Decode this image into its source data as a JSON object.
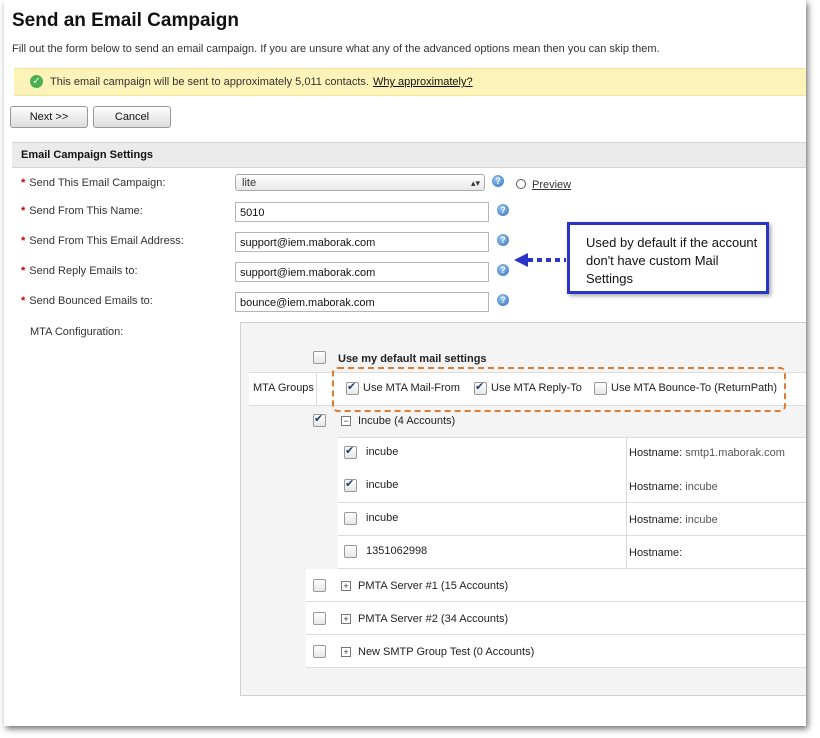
{
  "page": {
    "title": "Send an Email Campaign",
    "intro": "Fill out the form below to send an email campaign. If you are unsure what any of the advanced options mean then you can skip them."
  },
  "notice": {
    "message": "This email campaign will be sent to approximately 5,011 contacts.",
    "link": "Why approximately?"
  },
  "buttons": {
    "next": "Next >>",
    "cancel": "Cancel"
  },
  "section": {
    "title": "Email Campaign Settings"
  },
  "form": {
    "campaign_label": "Send This Email Campaign:",
    "campaign_value": "lite",
    "preview": "Preview",
    "from_name_label": "Send From This Name:",
    "from_name_value": "5010",
    "from_email_label": "Send From This Email Address:",
    "from_email_value": "support@iem.maborak.com",
    "reply_label": "Send Reply Emails to:",
    "reply_value": "support@iem.maborak.com",
    "bounce_label": "Send Bounced Emails to:",
    "bounce_value": "bounce@iem.maborak.com",
    "mta_label": "MTA Configuration:"
  },
  "mta": {
    "default_settings": "Use my default mail settings",
    "groups_label": "MTA Groups",
    "mail_from": "Use MTA Mail-From",
    "reply_to": "Use MTA Reply-To",
    "bounce_to": "Use MTA Bounce-To (ReturnPath)",
    "group_incube": "Incube (4 Accounts)",
    "hostname_label": "Hostname:",
    "accounts": [
      {
        "name": "incube",
        "host": "smtp1.maborak.com"
      },
      {
        "name": "incube",
        "host": "incube"
      },
      {
        "name": "incube",
        "host": "incube"
      },
      {
        "name": "1351062998",
        "host": ""
      }
    ],
    "groups": [
      {
        "name": "PMTA Server #1 (15 Accounts)"
      },
      {
        "name": "PMTA Server #2 (34 Accounts)"
      },
      {
        "name": "New SMTP Group Test (0 Accounts)"
      }
    ]
  },
  "callout": {
    "text": "Used by default if  the account don't have custom Mail Settings"
  },
  "colors": {
    "callout_border": "#2a34c8",
    "dash_border": "#e07a2e",
    "notice_bg": "#fbf3b8"
  }
}
